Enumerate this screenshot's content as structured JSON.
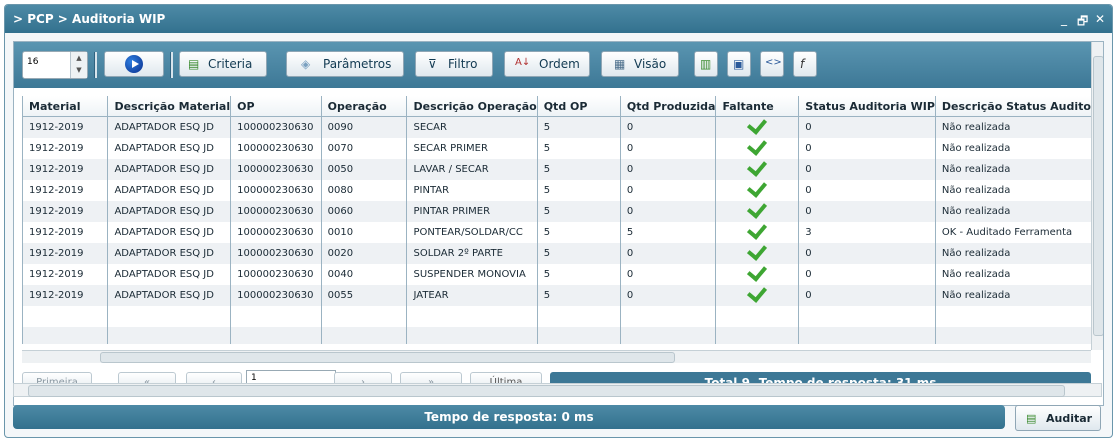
{
  "window": {
    "title": "> PCP > Auditoria WIP",
    "controls": [
      "_",
      "🗗",
      "✕"
    ]
  },
  "toolbar": {
    "rows_per_page": "16",
    "criteria_label": "Criteria",
    "parametros_label": "Parâmetros",
    "filtro_label": "Filtro",
    "ordem_label": "Ordem",
    "visao_label": "Visão",
    "icons": [
      "play-icon",
      "export-icon",
      "save-icon",
      "code-icon",
      "function-icon"
    ]
  },
  "table": {
    "columns": [
      "Material",
      "Descrição Material",
      "OP",
      "Operação",
      "Descrição Operação",
      "Qtd OP",
      "Qtd Produzida",
      "Faltante",
      "Status Auditoria WIP",
      "Descrição Status Audito"
    ],
    "rows": [
      [
        "1912-2019",
        "ADAPTADOR ESQ JD",
        "100000230630",
        "0090",
        "SECAR",
        "5",
        "0",
        "✓",
        "0",
        "Não realizada"
      ],
      [
        "1912-2019",
        "ADAPTADOR ESQ JD",
        "100000230630",
        "0070",
        "SECAR PRIMER",
        "5",
        "0",
        "✓",
        "0",
        "Não realizada"
      ],
      [
        "1912-2019",
        "ADAPTADOR ESQ JD",
        "100000230630",
        "0050",
        "LAVAR / SECAR",
        "5",
        "0",
        "✓",
        "0",
        "Não realizada"
      ],
      [
        "1912-2019",
        "ADAPTADOR ESQ JD",
        "100000230630",
        "0080",
        "PINTAR",
        "5",
        "0",
        "✓",
        "0",
        "Não realizada"
      ],
      [
        "1912-2019",
        "ADAPTADOR ESQ JD",
        "100000230630",
        "0060",
        "PINTAR PRIMER",
        "5",
        "0",
        "✓",
        "0",
        "Não realizada"
      ],
      [
        "1912-2019",
        "ADAPTADOR ESQ JD",
        "100000230630",
        "0010",
        "PONTEAR/SOLDAR/CC",
        "5",
        "5",
        "✓",
        "3",
        "OK - Auditado Ferramenta"
      ],
      [
        "1912-2019",
        "ADAPTADOR ESQ JD",
        "100000230630",
        "0020",
        "SOLDAR 2º PARTE",
        "5",
        "0",
        "✓",
        "0",
        "Não realizada"
      ],
      [
        "1912-2019",
        "ADAPTADOR ESQ JD",
        "100000230630",
        "0040",
        "SUSPENDER MONOVIA",
        "5",
        "0",
        "✓",
        "0",
        "Não realizada"
      ],
      [
        "1912-2019",
        "ADAPTADOR ESQ JD",
        "100000230630",
        "0055",
        "JATEAR",
        "5",
        "0",
        "✓",
        "0",
        "Não realizada"
      ]
    ]
  },
  "pager": {
    "first_label": "Primeira",
    "last_label": "Última",
    "page_value": "1",
    "total_text": "Total 9. Tempo de resposta: 31 ms"
  },
  "footer": {
    "status_text": "Tempo de resposta: 0 ms",
    "auditar_label": "Auditar"
  }
}
